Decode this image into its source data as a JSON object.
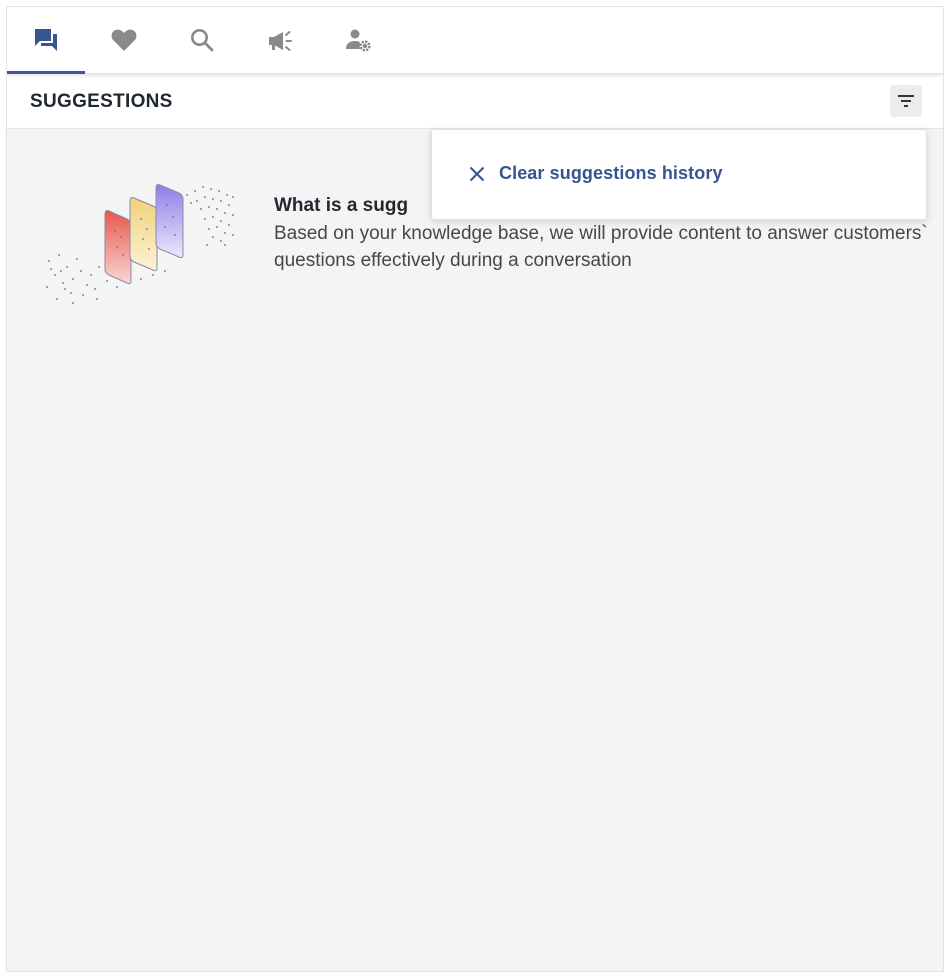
{
  "tabs": [
    {
      "icon": "chat-bubbles-icon",
      "active": true
    },
    {
      "icon": "heart-icon",
      "active": false
    },
    {
      "icon": "search-icon",
      "active": false
    },
    {
      "icon": "megaphone-icon",
      "active": false
    },
    {
      "icon": "user-settings-icon",
      "active": false
    }
  ],
  "header": {
    "title": "SUGGESTIONS",
    "filter_icon": "filter-icon"
  },
  "menu": {
    "items": [
      {
        "icon": "close-icon",
        "label": "Clear suggestions history"
      }
    ]
  },
  "empty_state": {
    "title": "What is a sugg",
    "description": "Based on your knowledge base, we will provide content to answer customers` questions effectively during a conversation"
  },
  "colors": {
    "accent": "#3c5a96",
    "active_icon": "#3a5490",
    "inactive_icon": "#8a8a8a",
    "menu_text": "#36558f"
  }
}
